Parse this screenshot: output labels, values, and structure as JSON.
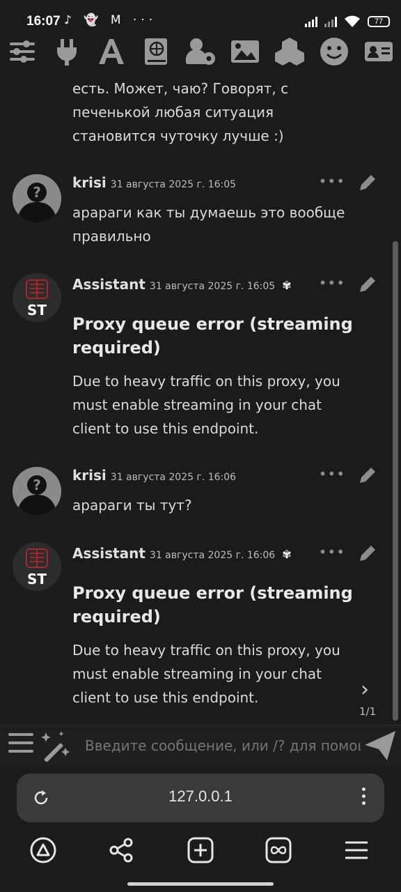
{
  "status_bar": {
    "time": "16:07",
    "app_icons": "♪ 👻 M ···",
    "battery": "77"
  },
  "toolbar": {
    "icons": [
      "sliders-icon",
      "plug-icon",
      "font-icon",
      "book-globe-icon",
      "user-gear-icon",
      "image-icon",
      "cubes-icon",
      "smiley-icon",
      "id-card-icon"
    ]
  },
  "messages": [
    {
      "kind": "partial",
      "text": "есть. Может, чаю? Говорят, с печенькой любая ситуация становится чуточку лучше :)"
    },
    {
      "kind": "user",
      "name": "krisi",
      "time": "31 августа 2025 г. 16:05",
      "text": "арараги как ты думаешь это вообще правильно"
    },
    {
      "kind": "assistant",
      "name": "Assistant",
      "time": "31 августа 2025 г. 16:05",
      "heading": "Proxy queue error (streaming required)",
      "text": "Due to heavy traffic on this proxy, you must enable streaming in your chat client to use this endpoint."
    },
    {
      "kind": "user",
      "name": "krisi",
      "time": "31 августа 2025 г. 16:06",
      "text": "арараги ты тут?"
    },
    {
      "kind": "assistant",
      "name": "Assistant",
      "time": "31 августа 2025 г. 16:06",
      "heading": "Proxy queue error (streaming required)",
      "text": "Due to heavy traffic on this proxy, you must enable streaming in your chat client to use this endpoint."
    }
  ],
  "swipe": {
    "arrow": "›",
    "counter": "1/1"
  },
  "avatar_badge": "ST",
  "input": {
    "placeholder": "Введите сообщение, или /? для помощи"
  },
  "browser": {
    "url": "127.0.0.1"
  },
  "colors": {
    "background": "#1b1b1b",
    "text": "#dadada",
    "icon": "#9a9a9a"
  }
}
